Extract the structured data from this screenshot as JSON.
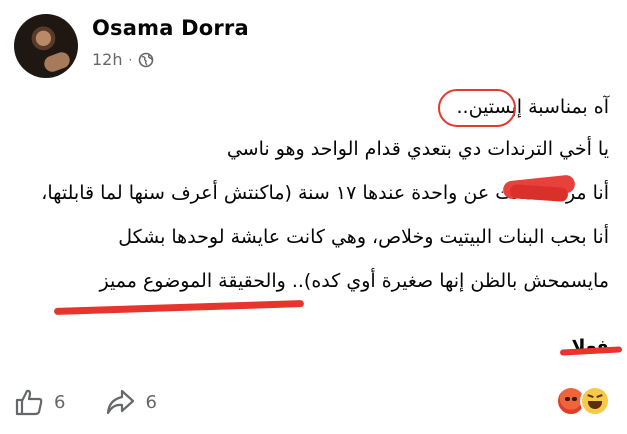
{
  "post": {
    "author": "Osama Dorra",
    "time": "12h",
    "separator": "·",
    "privacy_icon": "globe-icon",
    "lines": [
      "آه بمناسبة إبستين..",
      "يا أخي الترندات دي بتعدي قدام الواحد وهو ناسي",
      "أنا مرة سمعت عن واحدة عندها ١٧ سنة (ماكنتش أعرف سنها لما قابلتها،",
      "أنا بحب البنات البيتيت وخلاص، وهي كانت عايشة لوحدها بشكل",
      "مايسمحش بالظن إنها صغيرة أوي كده).. والحقيقة الموضوع مميز",
      "فعلا"
    ],
    "line3_hidden_word": "سمعت"
  },
  "actions": {
    "like_icon": "thumbs-up-icon",
    "like_count": "6",
    "share_icon": "share-arrow-icon",
    "share_count": "6"
  },
  "reactions": {
    "icons": [
      "angry-emoji-icon",
      "haha-emoji-icon"
    ]
  },
  "colors": {
    "annotation_red": "#e8342c",
    "meta_gray": "#65676b",
    "text": "#050505"
  }
}
